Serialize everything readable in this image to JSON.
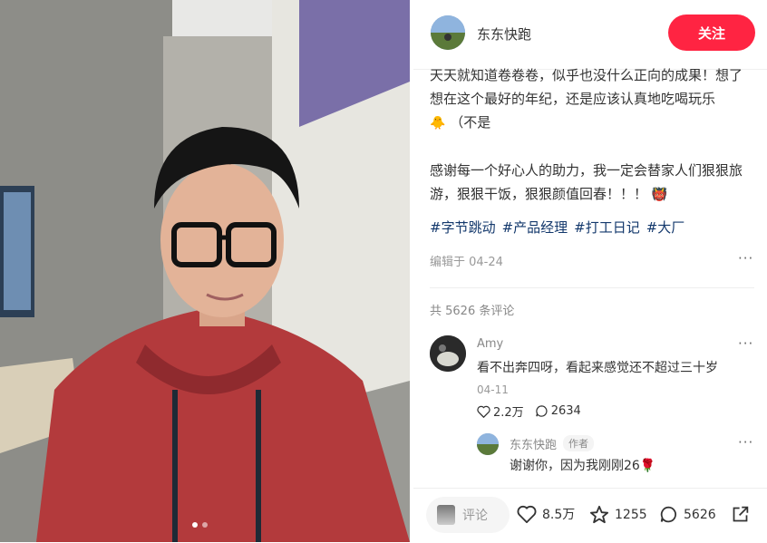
{
  "post": {
    "author": "东东快跑",
    "follow_label": "关注",
    "content_line1": "天天就知道卷卷卷，似乎也没什么正向的成果！想了想在这个最好的年纪，还是应该认真地吃喝玩乐",
    "content_line1_tail": "（不是",
    "content_line2": "感谢每一个好心人的助力，我一定会替家人们狠狠旅游，狠狠干饭，狠狠颜值回春！！！",
    "tags": [
      "#字节跳动",
      "#产品经理",
      "#打工日记",
      "#大厂"
    ],
    "edited": "编辑于 04-24",
    "more": "···"
  },
  "comments": {
    "count_label": "共 5626 条评论",
    "first": {
      "name": "Amy",
      "text": "看不出奔四呀，看起来感觉还不超过三十岁",
      "date": "04-11",
      "likes": "2.2万",
      "replies": "2634"
    },
    "reply": {
      "name": "东东快跑",
      "badge": "作者",
      "text": "谢谢你，因为我刚刚26"
    }
  },
  "bottom_bar": {
    "comment_placeholder": "评论",
    "likes": "8.5万",
    "favorites": "1255",
    "comments": "5626"
  },
  "colors": {
    "accent": "#ff2442",
    "tag": "#13386c"
  },
  "carousel": {
    "total": 2,
    "active": 0
  }
}
